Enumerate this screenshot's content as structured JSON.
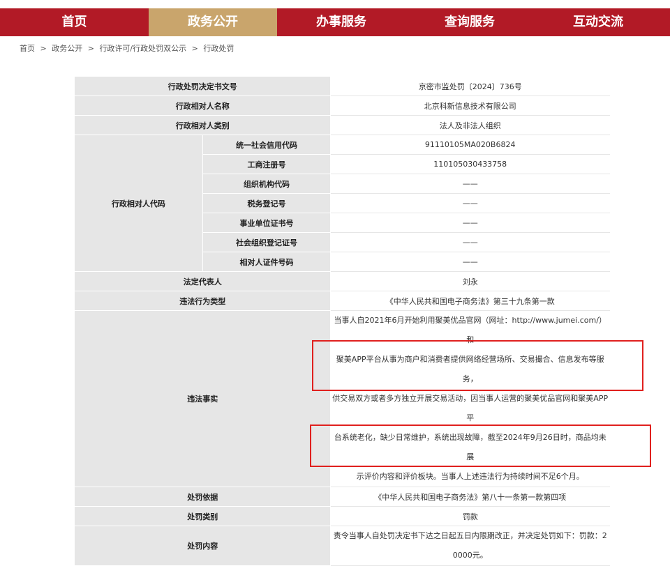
{
  "nav": {
    "items": [
      {
        "label": "首页"
      },
      {
        "label": "政务公开"
      },
      {
        "label": "办事服务"
      },
      {
        "label": "查询服务"
      },
      {
        "label": "互动交流"
      }
    ]
  },
  "breadcrumb": [
    "首页",
    ">",
    "政务公开",
    ">",
    "行政许可/行政处罚双公示",
    ">",
    "行政处罚"
  ],
  "table": {
    "doc_no": {
      "label": "行政处罚决定书文号",
      "value": "京密市监处罚〔2024〕736号"
    },
    "party_name": {
      "label": "行政相对人名称",
      "value": "北京科新信息技术有限公司"
    },
    "party_type": {
      "label": "行政相对人类别",
      "value": "法人及非法人组织"
    },
    "party_code": {
      "label": "行政相对人代码",
      "rows": [
        {
          "label": "统一社会信用代码",
          "value": "91110105MA020B6824"
        },
        {
          "label": "工商注册号",
          "value": "110105030433758"
        },
        {
          "label": "组织机构代码",
          "value": "——"
        },
        {
          "label": "税务登记号",
          "value": "——"
        },
        {
          "label": "事业单位证书号",
          "value": "——"
        },
        {
          "label": "社会组织登记证号",
          "value": "——"
        },
        {
          "label": "相对人证件号码",
          "value": "——"
        }
      ]
    },
    "legal_rep": {
      "label": "法定代表人",
      "value": "刘永"
    },
    "violation_type": {
      "label": "违法行为类型",
      "value": "《中华人民共和国电子商务法》第三十九条第一款"
    },
    "facts": {
      "label": "违法事实",
      "lines": [
        "当事人自2021年6月开始利用聚美优品官网（网址：http://www.jumei.com/）和",
        "聚美APP平台从事为商户和消费者提供网络经营场所、交易撮合、信息发布等服务，",
        "供交易双方或者多方独立开展交易活动，因当事人运营的聚美优品官网和聚美APP平",
        "台系统老化，缺少日常维护，系统出现故障，截至2024年9月26日时，商品均未展",
        "示评价内容和评价板块。当事人上述违法行为持续时间不足6个月。"
      ]
    },
    "basis": {
      "label": "处罚依据",
      "value": "《中华人民共和国电子商务法》第八十一条第一款第四项"
    },
    "category": {
      "label": "处罚类别",
      "value": "罚款"
    },
    "content": {
      "label": "处罚内容",
      "lines": [
        "责令当事人自处罚决定书下达之日起五日内限期改正，并决定处罚如下：罚款：2",
        "0000元。"
      ]
    }
  },
  "colors": {
    "nav_bg": "#b21a26",
    "nav_active": "#c9a56c",
    "label_bg": "#e6e6e6",
    "highlight": "#e0201e"
  }
}
